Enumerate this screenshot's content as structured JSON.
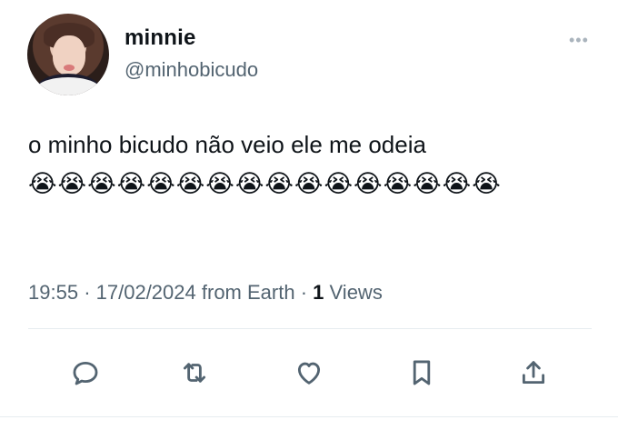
{
  "tweet": {
    "display_name": "minnie",
    "handle": "@minhobicudo",
    "text": "o minho bicudo não veio ele me odeia",
    "emojis": "😭😭😭😭😭😭😭😭😭😭😭😭😭😭😭😭",
    "time": "19:55",
    "date": "17/02/2024",
    "source": "from Earth",
    "views_count": "1",
    "views_label": "Views"
  },
  "actions": {
    "reply": "reply-icon",
    "retweet": "retweet-icon",
    "like": "heart-icon",
    "bookmark": "bookmark-icon",
    "share": "share-icon"
  },
  "more_icon": "more-icon"
}
